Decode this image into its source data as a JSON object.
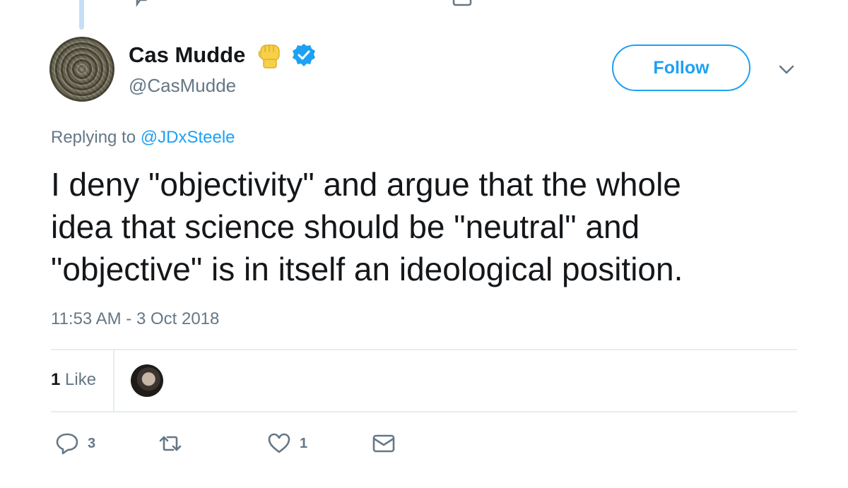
{
  "tweet": {
    "display_name": "Cas Mudde",
    "handle": "@CasMudde",
    "follow_label": "Follow",
    "replying_prefix": "Replying to",
    "replying_mention": "@JDxSteele",
    "text_lines": [
      "I deny \"objectivity\" and argue that the whole",
      "idea that science should be \"neutral\" and",
      "\"objective\" is in itself an ideological position."
    ],
    "timestamp": "11:53 AM - 3 Oct 2018",
    "likes": {
      "count": "1",
      "label": "Like"
    },
    "actions": {
      "replies": "3",
      "retweets": "",
      "likes": "1"
    }
  },
  "icons": {
    "fist": "raised-fist-emoji",
    "verified": "verified-badge-icon",
    "chevron": "chevron-down-icon",
    "reply": "reply-icon",
    "retweet": "retweet-icon",
    "like": "heart-icon",
    "dm": "envelope-icon"
  },
  "colors": {
    "accent": "#1da1f2",
    "secondary_text": "#657786",
    "divider": "#e6ecf0",
    "fist": "#f7d04a"
  }
}
